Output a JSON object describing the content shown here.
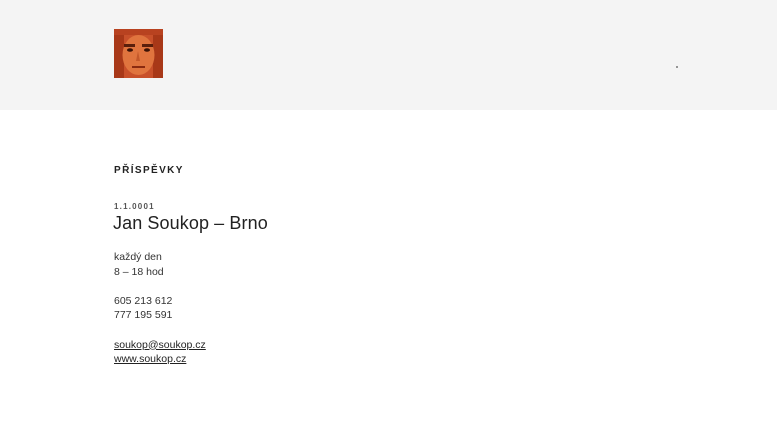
{
  "header": {
    "avatar_icon": "face-photo",
    "menu_icon": "dot-menu-icon"
  },
  "section": {
    "title": "Příspěvky"
  },
  "post": {
    "date": "1.1.0001",
    "title": "Jan Soukop – Brno",
    "hours": [
      "každý den",
      "8 – 18 hod"
    ],
    "phones": [
      "605 213 612",
      "777 195 591"
    ],
    "email": "soukop@soukop.cz",
    "website": "www.soukop.cz"
  },
  "colors": {
    "header_bg": "#f4f4f4",
    "text": "#222222",
    "avatar_accent": "#c44a22"
  }
}
